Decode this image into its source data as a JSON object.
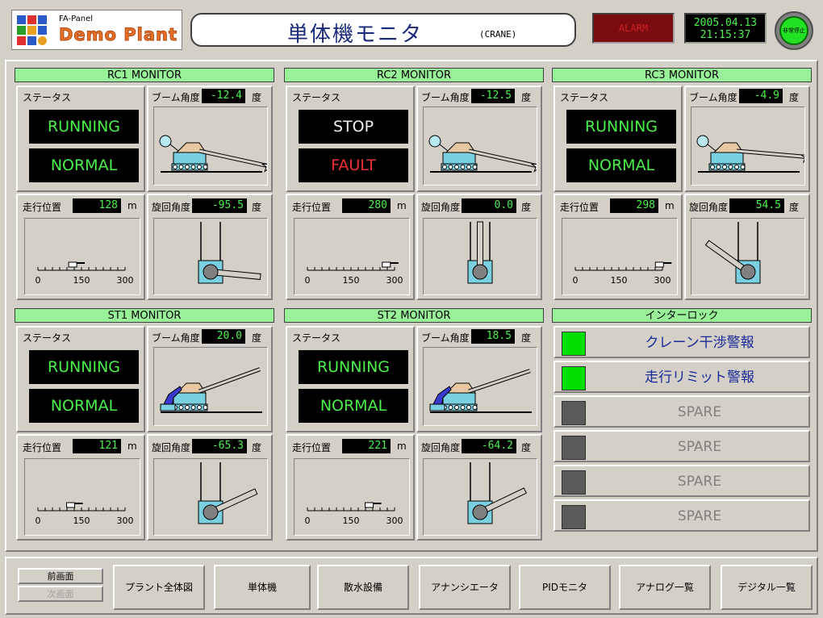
{
  "header": {
    "logo_sub": "FA-Panel",
    "logo_main": "Demo Plant",
    "title": "単体機モニタ",
    "subtitle": "(CRANE)",
    "alarm_label": "ALARM",
    "clock_date": "2005.04.13",
    "clock_time": "21:15:37",
    "estop_label": "非常停止"
  },
  "labels": {
    "status": "ステータス",
    "boom_angle": "ブーム角度",
    "travel_pos": "走行位置",
    "swing_angle": "旋回角度",
    "deg": "度",
    "m": "m",
    "scale_0": "0",
    "scale_150": "150",
    "scale_300": "300"
  },
  "monitors": [
    {
      "title": "RC1 MONITOR",
      "type": "rc",
      "status1": "RUNNING",
      "status2": "NORMAL",
      "status1_color": "green",
      "status2_color": "green",
      "boom": "-12.4",
      "boom_value": -12.4,
      "travel": "128",
      "travel_value": 128,
      "swing": "-95.5",
      "swing_value": -95.5
    },
    {
      "title": "RC2 MONITOR",
      "type": "rc",
      "status1": "STOP",
      "status2": "FAULT",
      "status1_color": "white",
      "status2_color": "red",
      "boom": "-12.5",
      "boom_value": -12.5,
      "travel": "280",
      "travel_value": 280,
      "swing": "0.0",
      "swing_value": 0.0
    },
    {
      "title": "RC3 MONITOR",
      "type": "rc",
      "status1": "RUNNING",
      "status2": "NORMAL",
      "status1_color": "green",
      "status2_color": "green",
      "boom": "-4.9",
      "boom_value": -4.9,
      "travel": "298",
      "travel_value": 298,
      "swing": "54.5",
      "swing_value": 54.5
    },
    {
      "title": "ST1 MONITOR",
      "type": "st",
      "status1": "RUNNING",
      "status2": "NORMAL",
      "status1_color": "green",
      "status2_color": "green",
      "boom": "20.0",
      "boom_value": 20.0,
      "travel": "121",
      "travel_value": 121,
      "swing": "-65.3",
      "swing_value": -65.3
    },
    {
      "title": "ST2 MONITOR",
      "type": "st",
      "status1": "RUNNING",
      "status2": "NORMAL",
      "status1_color": "green",
      "status2_color": "green",
      "boom": "18.5",
      "boom_value": 18.5,
      "travel": "221",
      "travel_value": 221,
      "swing": "-64.2",
      "swing_value": -64.2
    }
  ],
  "interlock": {
    "title": "インターロック",
    "items": [
      {
        "label": "クレーン干渉警報",
        "active": true
      },
      {
        "label": "走行リミット警報",
        "active": true
      },
      {
        "label": "SPARE",
        "active": false
      },
      {
        "label": "SPARE",
        "active": false
      },
      {
        "label": "SPARE",
        "active": false
      },
      {
        "label": "SPARE",
        "active": false
      }
    ]
  },
  "colors": {
    "lamp_on": "#00e000",
    "lamp_off": "#5a5a5a",
    "text_active": "#1a2a9a",
    "text_spare": "#808080"
  },
  "footer": {
    "prev": "前画面",
    "next": "次画面",
    "buttons": [
      "プラント全体図",
      "単体機",
      "散水設備",
      "アナンシエータ",
      "PIDモニタ",
      "アナログ一覧",
      "デジタル一覧"
    ]
  }
}
